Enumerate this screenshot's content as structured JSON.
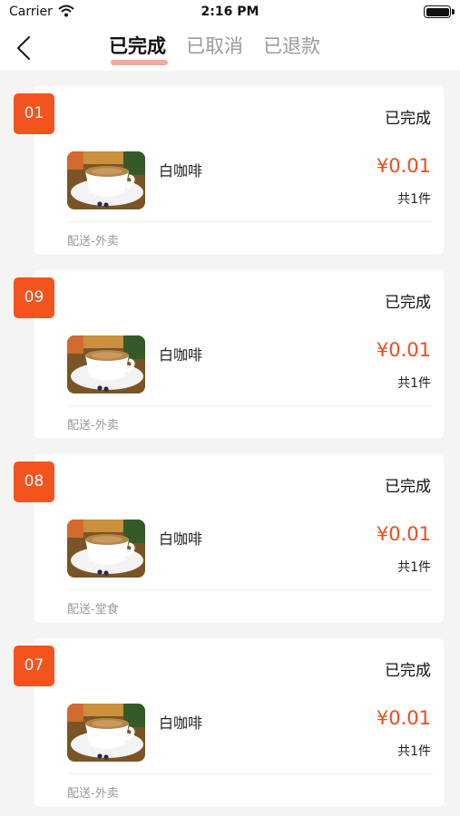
{
  "statusbar": {
    "carrier": "Carrier",
    "time": "2:16 PM",
    "wifi_icon": "wifi-icon",
    "battery_icon": "battery-icon"
  },
  "nav": {
    "back_icon": "chevron-left-icon",
    "tabs": [
      {
        "label": "已完成",
        "active": true
      },
      {
        "label": "已取消",
        "active": false
      },
      {
        "label": "已退款",
        "active": false
      }
    ]
  },
  "colors": {
    "accent": "#f2531f",
    "price": "#ef4c1a",
    "tab_underline": "#f6a9a0",
    "background": "#f4f4f4"
  },
  "orders": [
    {
      "number": "01",
      "status": "已完成",
      "product": "白咖啡",
      "price": "¥0.01",
      "count": "共1件",
      "delivery": "配送-外卖"
    },
    {
      "number": "09",
      "status": "已完成",
      "product": "白咖啡",
      "price": "¥0.01",
      "count": "共1件",
      "delivery": "配送-外卖"
    },
    {
      "number": "08",
      "status": "已完成",
      "product": "白咖啡",
      "price": "¥0.01",
      "count": "共1件",
      "delivery": "配送-堂食"
    },
    {
      "number": "07",
      "status": "已完成",
      "product": "白咖啡",
      "price": "¥0.01",
      "count": "共1件",
      "delivery": "配送-外卖"
    }
  ]
}
